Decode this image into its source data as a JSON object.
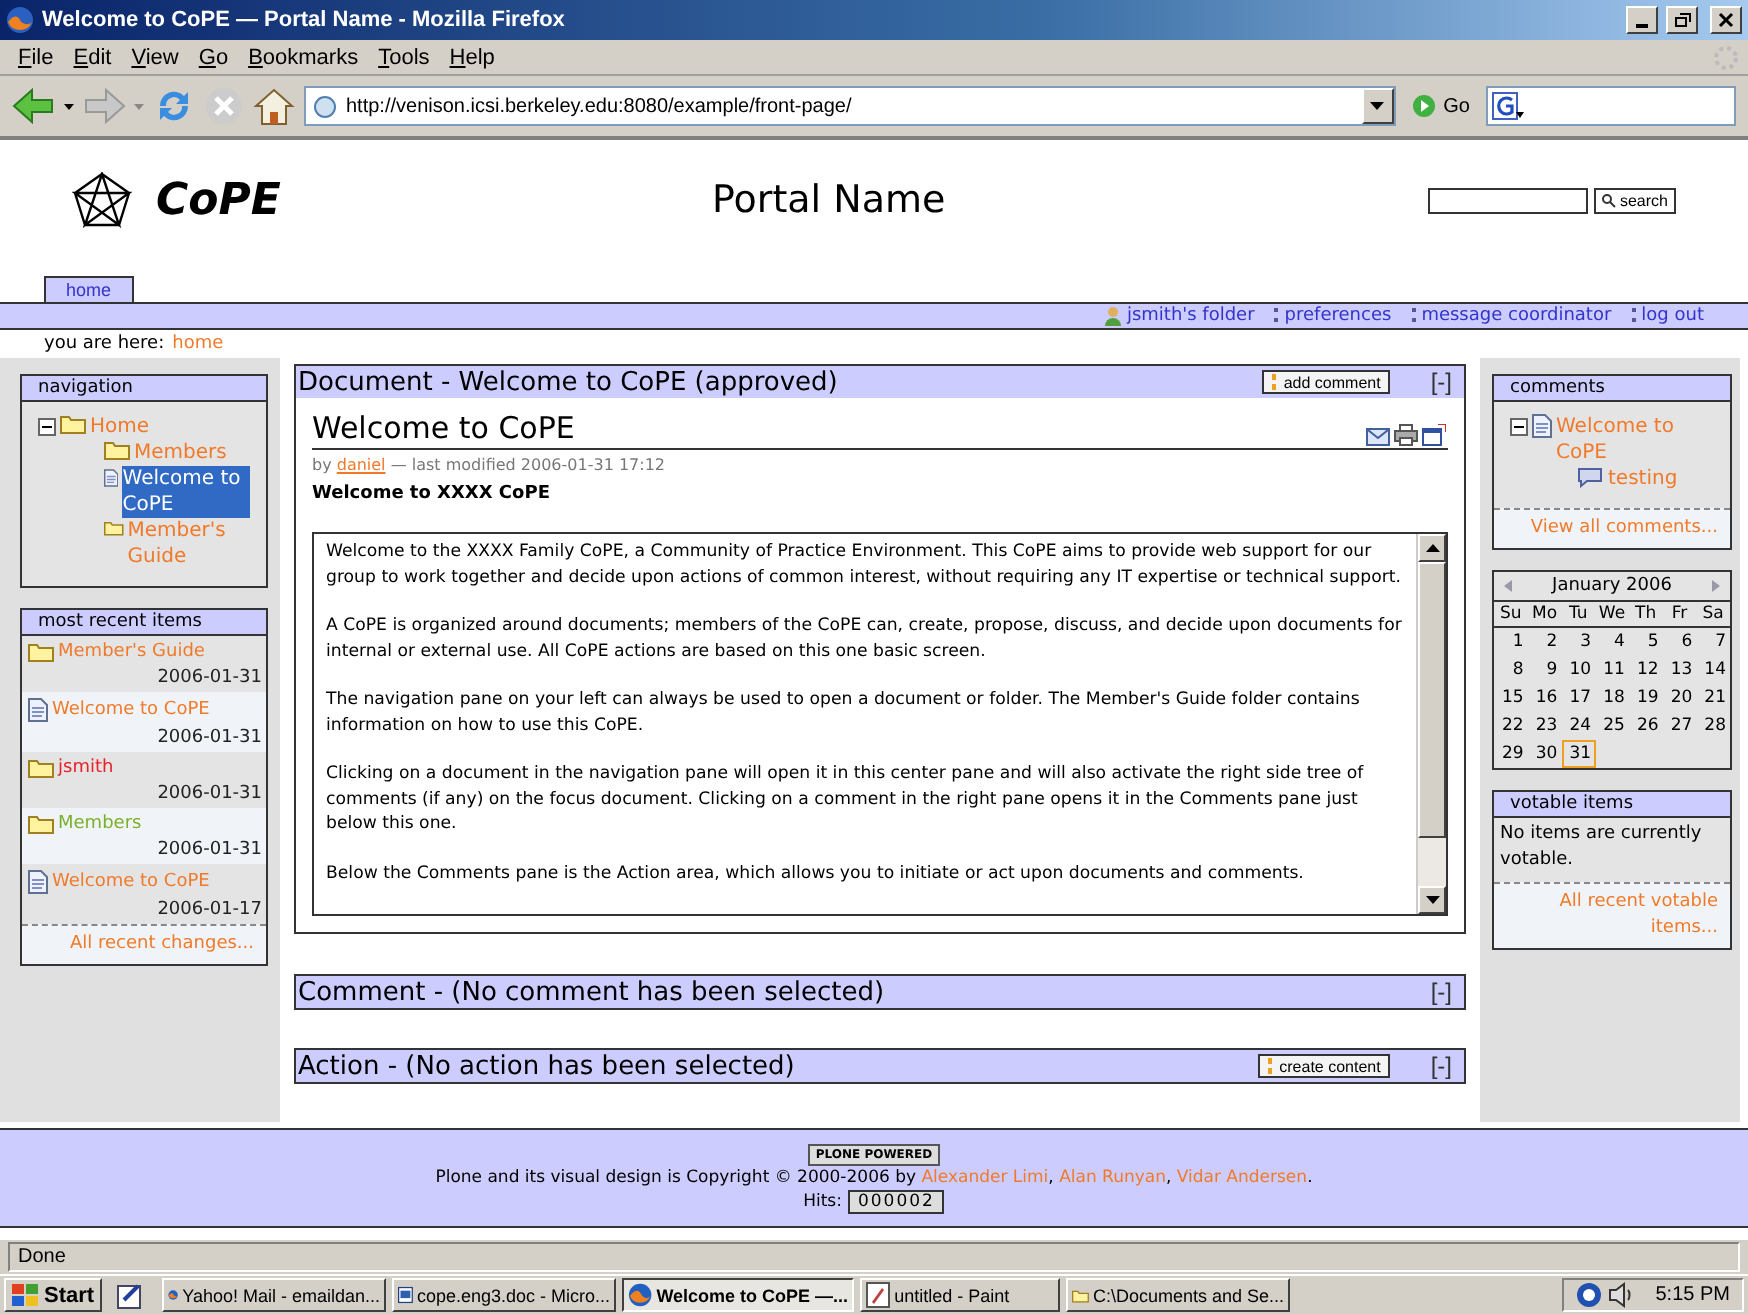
{
  "window": {
    "title": "Welcome to CoPE — Portal Name - Mozilla Firefox"
  },
  "menu": [
    "File",
    "Edit",
    "View",
    "Go",
    "Bookmarks",
    "Tools",
    "Help"
  ],
  "toolbar": {
    "address": "http://venison.icsi.berkeley.edu:8080/example/front-page/",
    "go_label": "Go"
  },
  "site": {
    "logo_text": "CoPE",
    "portal_name": "Portal Name",
    "search_button": "search"
  },
  "tabs": [
    {
      "label": "home",
      "selected": true
    }
  ],
  "personal_bar": [
    {
      "label": "jsmith's folder",
      "kind": "user"
    },
    {
      "label": "preferences",
      "kind": "link"
    },
    {
      "label": "message coordinator",
      "kind": "link"
    },
    {
      "label": "log out",
      "kind": "link"
    }
  ],
  "breadcrumb": {
    "label": "you are here:",
    "link": "home"
  },
  "navigation": {
    "title": "navigation",
    "items": [
      {
        "label": "Home",
        "kind": "folder",
        "selected": false,
        "expanded": true,
        "children": [
          {
            "label": "Members",
            "kind": "folder",
            "selected": false
          },
          {
            "label": "Welcome to CoPE",
            "kind": "document",
            "selected": true
          },
          {
            "label": "Member's Guide",
            "kind": "folder",
            "selected": false
          }
        ]
      }
    ]
  },
  "recent": {
    "title": "most recent items",
    "items": [
      {
        "label": "Member's Guide",
        "kind": "folder",
        "date": "2006-01-31",
        "color": "#f07a2a"
      },
      {
        "label": "Welcome to CoPE",
        "kind": "document",
        "date": "2006-01-31",
        "color": "#f07a2a"
      },
      {
        "label": "jsmith",
        "kind": "folder",
        "date": "2006-01-31",
        "color": "#e8202a"
      },
      {
        "label": "Members",
        "kind": "folder",
        "date": "2006-01-31",
        "color": "#7ab02a"
      },
      {
        "label": "Welcome to CoPE",
        "kind": "document",
        "date": "2006-01-17",
        "color": "#f07a2a"
      }
    ],
    "footer_link": "All recent changes..."
  },
  "document": {
    "header": "Document - Welcome to CoPE (approved)",
    "button": "add comment",
    "collapse": "[-]",
    "title": "Welcome to CoPE",
    "byline_prefix": "by",
    "author": "daniel",
    "byline_suffix": "— last modified 2006-01-31 17:12",
    "description": "Welcome to XXXX CoPE",
    "paragraphs": [
      "Welcome to the XXXX Family CoPE, a Community of Practice Environment. This CoPE aims to provide web support for our group to work together and decide upon actions of common interest, without requiring any IT expertise or technical support.",
      "A CoPE is organized around documents; members of the CoPE can, create, propose, discuss, and decide upon documents for internal or external use. All CoPE actions are based on this one basic screen.",
      "The navigation pane on your left can always be used to open a document or folder. The Member's Guide folder contains information on how to use this CoPE.",
      "Clicking on a document in the navigation pane will open it in this center pane and will also activate the right side tree of comments (if any) on the focus document. Clicking on a comment in the right pane opens it in the Comments pane just below this one.",
      "Below the Comments pane is the Action area, which allows you to initiate or act upon documents and comments."
    ]
  },
  "comment_pane": {
    "header": "Comment - (No comment has been selected)",
    "collapse": "[-]"
  },
  "action_pane": {
    "header": "Action - (No action has been selected)",
    "button": "create content",
    "collapse": "[-]"
  },
  "comments": {
    "title": "comments",
    "items": [
      {
        "label": "Welcome to CoPE",
        "kind": "document",
        "expanded": true,
        "children": [
          {
            "label": "testing",
            "kind": "comment"
          }
        ]
      }
    ],
    "footer_link": "View all comments..."
  },
  "calendar": {
    "month": "January 2006",
    "weekdays": [
      "Su",
      "Mo",
      "Tu",
      "We",
      "Th",
      "Fr",
      "Sa"
    ],
    "days": [
      {
        "day": "1",
        "selected": false
      },
      {
        "day": "2",
        "selected": false
      },
      {
        "day": "3",
        "selected": false
      },
      {
        "day": "4",
        "selected": false
      },
      {
        "day": "5",
        "selected": false
      },
      {
        "day": "6",
        "selected": false
      },
      {
        "day": "7",
        "selected": false
      },
      {
        "day": "8",
        "selected": false
      },
      {
        "day": "9",
        "selected": false
      },
      {
        "day": "10",
        "selected": false
      },
      {
        "day": "11",
        "selected": false
      },
      {
        "day": "12",
        "selected": false
      },
      {
        "day": "13",
        "selected": false
      },
      {
        "day": "14",
        "selected": false
      },
      {
        "day": "15",
        "selected": false
      },
      {
        "day": "16",
        "selected": false
      },
      {
        "day": "17",
        "selected": false
      },
      {
        "day": "18",
        "selected": false
      },
      {
        "day": "19",
        "selected": false
      },
      {
        "day": "20",
        "selected": false
      },
      {
        "day": "21",
        "selected": false
      },
      {
        "day": "22",
        "selected": false
      },
      {
        "day": "23",
        "selected": false
      },
      {
        "day": "24",
        "selected": false
      },
      {
        "day": "25",
        "selected": false
      },
      {
        "day": "26",
        "selected": false
      },
      {
        "day": "27",
        "selected": false
      },
      {
        "day": "28",
        "selected": false
      },
      {
        "day": "29",
        "selected": false
      },
      {
        "day": "30",
        "selected": false
      },
      {
        "day": "31",
        "selected": true
      }
    ]
  },
  "votable": {
    "title": "votable items",
    "message": "No items are currently votable.",
    "footer_link": "All recent votable items..."
  },
  "footer": {
    "badge": "PLONE POWERED",
    "copyright": "Plone and its visual design is Copyright © 2000-2006 by",
    "authors": [
      "Alexander Limi",
      "Alan Runyan",
      "Vidar Andersen"
    ],
    "author_separator": ",",
    "copyright_end": ".",
    "hits_label": "Hits:",
    "hits": "000002"
  },
  "status_bar": {
    "text": "Done"
  },
  "taskbar": {
    "start": "Start",
    "tasks": [
      {
        "label": "Yahoo! Mail - emaildan...",
        "kind": "browser",
        "selected": false
      },
      {
        "label": "cope.eng3.doc - Micro...",
        "kind": "word",
        "selected": false
      },
      {
        "label": "Welcome to CoPE —...",
        "kind": "browser",
        "selected": true
      },
      {
        "label": "untitled - Paint",
        "kind": "paint",
        "selected": false
      },
      {
        "label": "C:\\Documents and Se...",
        "kind": "folder",
        "selected": false
      }
    ],
    "clock": "5:15 PM"
  }
}
